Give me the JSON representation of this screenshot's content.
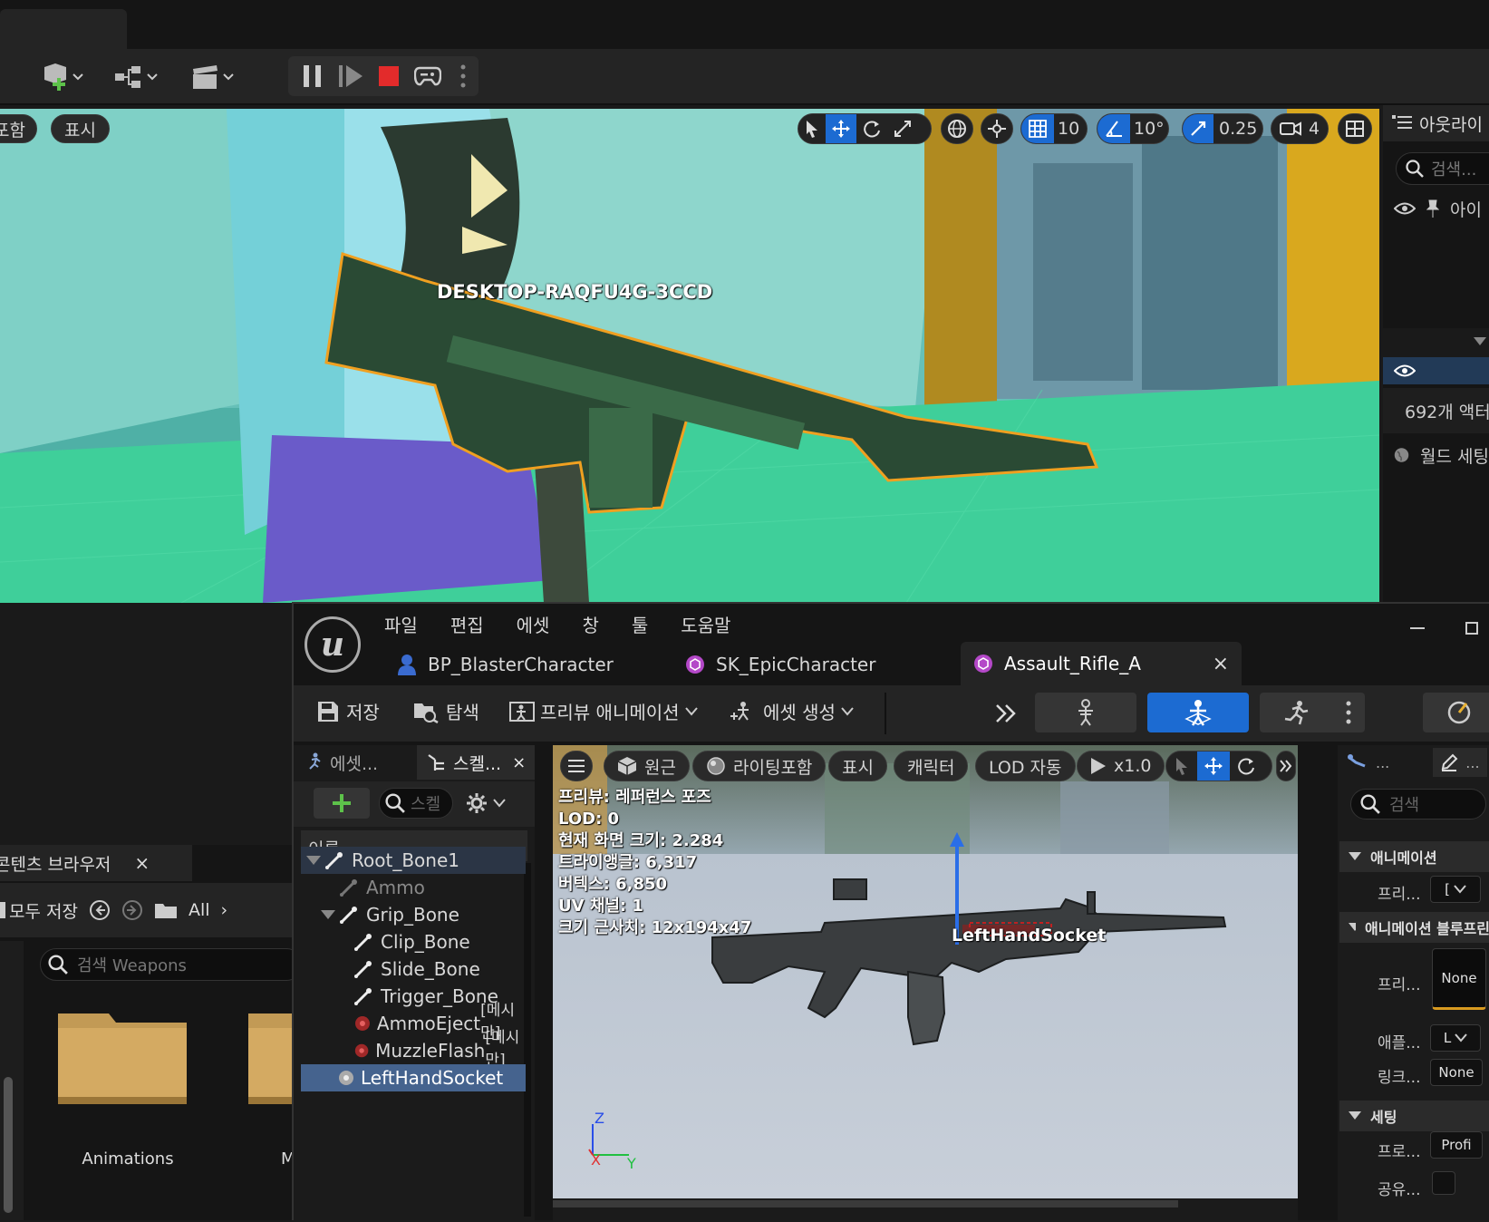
{
  "level_toolbar": {
    "play_controls": [
      "pause",
      "step",
      "stop",
      "possess"
    ]
  },
  "main_viewport": {
    "left_pills": [
      "포함",
      "표시"
    ],
    "grid_snap": "10",
    "rotation_snap": "10°",
    "scale_snap": "0.25",
    "camera_speed": "4",
    "player_label": "DESKTOP-RAQFU4G-3CCD"
  },
  "outliner": {
    "title": "아웃라이",
    "search_placeholder": "검색...",
    "column": "아이",
    "actor_count": "692개 액터",
    "world_settings": "월드 세팅"
  },
  "content_browser": {
    "title": "콘텐츠 브라우저",
    "save_all": "모두 저장",
    "path_root": "All",
    "search_placeholder": "검색 Weapons",
    "folders": [
      "Animations",
      "M"
    ]
  },
  "editor_window": {
    "menu": [
      "파일",
      "편집",
      "에셋",
      "창",
      "툴",
      "도움말"
    ],
    "tabs": [
      {
        "label": "BP_BlasterCharacter"
      },
      {
        "label": "SK_EpicCharacter"
      },
      {
        "label": "Assault_Rifle_A"
      }
    ],
    "toolbar": {
      "save": "저장",
      "browse": "탐색",
      "preview_animation": "프리뷰 애니메이션",
      "create_asset": "에셋 생성"
    }
  },
  "skeleton_panel": {
    "tab_asset": "에셋...",
    "tab_skeleton": "스켈...",
    "search_placeholder": "스켈",
    "column_name": "이름",
    "bones": [
      {
        "name": "Root_Bone1",
        "suffix": ""
      },
      {
        "name": "Ammo",
        "suffix": ""
      },
      {
        "name": "Grip_Bone",
        "suffix": ""
      },
      {
        "name": "Clip_Bone",
        "suffix": ""
      },
      {
        "name": "Slide_Bone",
        "suffix": ""
      },
      {
        "name": "Trigger_Bone",
        "suffix": ""
      },
      {
        "name": "AmmoEject",
        "suffix": "[메시만]"
      },
      {
        "name": "MuzzleFlash",
        "suffix": "[메시만]"
      },
      {
        "name": "LeftHandSocket",
        "suffix": ""
      }
    ]
  },
  "preview_viewport": {
    "pills": [
      "원근",
      "라이팅포함",
      "표시",
      "캐릭터",
      "LOD 자동",
      "x1.0"
    ],
    "stats": [
      "프리뷰: 레퍼런스 포즈",
      "LOD: 0",
      "현재 화면 크기: 2.284",
      "트라이앵글: 6,317",
      "버텍스: 6,850",
      "UV 채널: 1",
      "크기 근사치: 12x194x47"
    ],
    "socket_label": "LeftHandSocket",
    "axes": {
      "z": "Z",
      "x": "X",
      "y": "Y"
    }
  },
  "details_panel": {
    "search_placeholder": "검색",
    "tab_dots": "...",
    "categories": {
      "animation": "애니메이션",
      "anim_blueprint": "애니메이션 블루프린",
      "settings": "세팅"
    },
    "rows": {
      "preview": "프리...",
      "preview2": "프리...",
      "preview2_value": "None",
      "apply": "애플...",
      "link": "링크...",
      "link_value": "None",
      "profile": "프로...",
      "profile_value": "Profi",
      "shared": "공유..."
    }
  },
  "colors": {
    "accent_blue": "#1c6bd2",
    "stop_red": "#e32b2b",
    "floor_green": "#3fcf9a",
    "selection_orange": "#f0a020"
  }
}
